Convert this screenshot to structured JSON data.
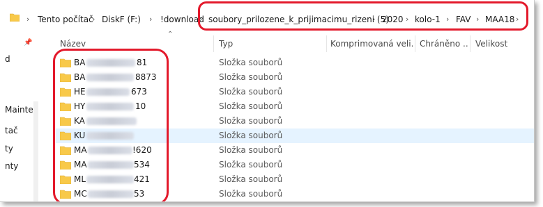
{
  "address": {
    "crumbs": [
      "Tento počítač",
      "DiskF (F:)",
      "!download",
      "soubory_prilozene_k_prijimacimu_rizeni (5)",
      "2020",
      "kolo-1",
      "FAV",
      "MAA18"
    ],
    "separator": "›"
  },
  "nav": {
    "items": [
      "d",
      "Mainten",
      "tač",
      "ty",
      "nty"
    ]
  },
  "columns": {
    "name": "Název",
    "type": "Typ",
    "compressed": "Komprimovaná veli...",
    "protected": "Chráněno ...",
    "size": "Velikost"
  },
  "rows": [
    {
      "prefix": "BA",
      "suffix": "81",
      "type": "Složka souborů"
    },
    {
      "prefix": "BA",
      "suffix": "8873",
      "type": "Složka souborů"
    },
    {
      "prefix": "HE",
      "suffix": "673",
      "type": "Složka souborů"
    },
    {
      "prefix": "HY",
      "suffix": "10",
      "type": "Složka souborů"
    },
    {
      "prefix": "KA",
      "suffix": "",
      "type": "Složka souborů"
    },
    {
      "prefix": "KU",
      "suffix": "",
      "type": "Složka souborů"
    },
    {
      "prefix": "MA",
      "suffix": "!620",
      "type": "Složka souborů"
    },
    {
      "prefix": "MA",
      "suffix": "534",
      "type": "Složka souborů"
    },
    {
      "prefix": "ML",
      "suffix": "421",
      "type": "Složka souborů"
    },
    {
      "prefix": "MC",
      "suffix": "53",
      "type": "Složka souborů"
    }
  ],
  "colors": {
    "folder": "#f8c94a",
    "highlight": "#e3192b",
    "hover": "#e5f3ff"
  }
}
